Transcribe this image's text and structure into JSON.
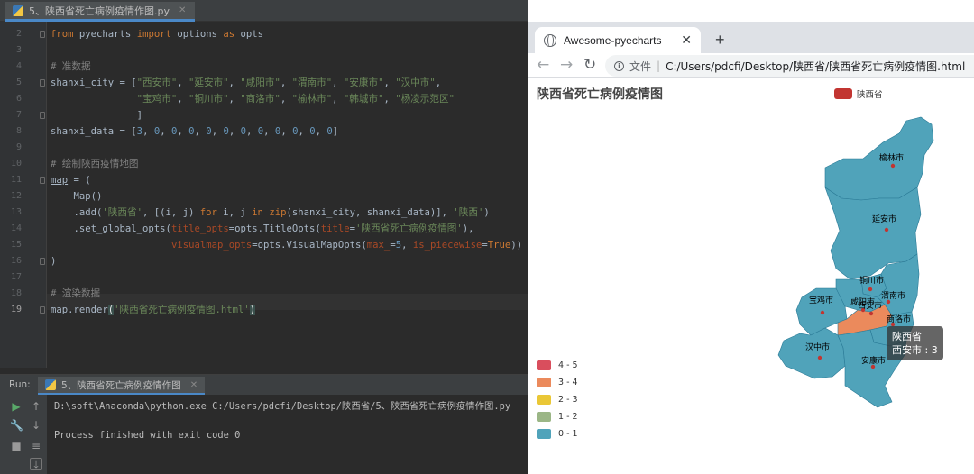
{
  "ide": {
    "file_tab": "5、陕西省死亡病例疫情作图.py",
    "lines": [
      {
        "num": "2",
        "html": "<span class='k'>from</span> pyecharts <span class='k'>import</span> options <span class='k'>as</span> opts"
      },
      {
        "num": "3",
        "html": ""
      },
      {
        "num": "4",
        "html": "<span class='c'># 准数据</span>"
      },
      {
        "num": "5",
        "html": "shanxi_city = [<span class='s'>\"西安市\"</span>, <span class='s'>\"延安市\"</span>, <span class='s'>\"咸阳市\"</span>, <span class='s'>\"渭南市\"</span>, <span class='s'>\"安康市\"</span>, <span class='s'>\"汉中市\"</span>,"
      },
      {
        "num": "6",
        "html": "               <span class='s'>\"宝鸡市\"</span>, <span class='s'>\"铜川市\"</span>, <span class='s'>\"商洛市\"</span>, <span class='s'>\"榆林市\"</span>, <span class='s'>\"韩城市\"</span>, <span class='s'>\"杨凌示范区\"</span>"
      },
      {
        "num": "7",
        "html": "               ]"
      },
      {
        "num": "8",
        "html": "shanxi_data = [<span class='n'>3</span>, <span class='n'>0</span>, <span class='n'>0</span>, <span class='n'>0</span>, <span class='n'>0</span>, <span class='n'>0</span>, <span class='n'>0</span>, <span class='n'>0</span>, <span class='n'>0</span>, <span class='n'>0</span>, <span class='n'>0</span>, <span class='n'>0</span>]"
      },
      {
        "num": "9",
        "html": ""
      },
      {
        "num": "10",
        "html": "<span class='c'># 绘制陕西疫情地图</span>"
      },
      {
        "num": "11",
        "html": "<span class='u'>map</span> = ("
      },
      {
        "num": "12",
        "html": "    Map()"
      },
      {
        "num": "13",
        "html": "    .add(<span class='s'>'陕西省'</span>, [(i, j) <span class='k'>for</span> i, j <span class='k'>in</span> <span class='k'>zip</span>(shanxi_city, shanxi_data)], <span class='s'>'陕西'</span>)"
      },
      {
        "num": "14",
        "html": "    .set_global_opts(<span class='p'>title_opts</span>=opts.TitleOpts(<span class='p'>title</span>=<span class='s'>'陕西省死亡病例疫情图'</span>),"
      },
      {
        "num": "15",
        "html": "                     <span class='p'>visualmap_opts</span>=opts.VisualMapOpts(<span class='p'>max_</span>=<span class='n'>5</span>, <span class='p'>is_piecewise</span>=<span class='k'>True</span>))"
      },
      {
        "num": "16",
        "html": ")"
      },
      {
        "num": "17",
        "html": ""
      },
      {
        "num": "18",
        "html": "<span class='c'># 渲染数据</span>"
      },
      {
        "num": "19",
        "html": "map.render<span class='bh'>(</span><span class='s'>'陕西省死亡病例疫情图.html'</span><span class='bh'>)</span>"
      }
    ],
    "run_label": "Run:",
    "run_tab": "5、陕西省死亡病例疫情作图",
    "output_command": "D:\\soft\\Anaconda\\python.exe C:/Users/pdcfi/Desktop/陕西省/5、陕西省死亡病例疫情作图.py",
    "output_exit": "Process finished with exit code 0"
  },
  "browser": {
    "tab_title": "Awesome-pyecharts",
    "address_label": "文件",
    "address_separator": "|",
    "address_url": "C:/Users/pdcfi/Desktop/陕西省/陕西省死亡病例疫情图.html"
  },
  "chart_data": {
    "type": "map",
    "title": "陕西省死亡病例疫情图",
    "legend": [
      {
        "name": "陕西省",
        "color": "#c23531"
      }
    ],
    "visual_map": {
      "pieces": [
        {
          "label": "4 - 5",
          "color": "#d94e5d"
        },
        {
          "label": "3 - 4",
          "color": "#eb8a5c"
        },
        {
          "label": "2 - 3",
          "color": "#eac736"
        },
        {
          "label": "1 - 2",
          "color": "#9bb686"
        },
        {
          "label": "0 - 1",
          "color": "#50a3ba"
        }
      ]
    },
    "regions": [
      {
        "name": "榆林市",
        "value": 0
      },
      {
        "name": "延安市",
        "value": 0
      },
      {
        "name": "铜川市",
        "value": 0
      },
      {
        "name": "宝鸡市",
        "value": 0
      },
      {
        "name": "咸阳市",
        "value": 0
      },
      {
        "name": "渭南市",
        "value": 0
      },
      {
        "name": "西安市",
        "value": 3
      },
      {
        "name": "商洛市",
        "value": 0
      },
      {
        "name": "汉中市",
        "value": 0
      },
      {
        "name": "安康市",
        "value": 0
      }
    ],
    "tooltip": {
      "series": "陕西省",
      "text": "西安市 : 3"
    }
  }
}
